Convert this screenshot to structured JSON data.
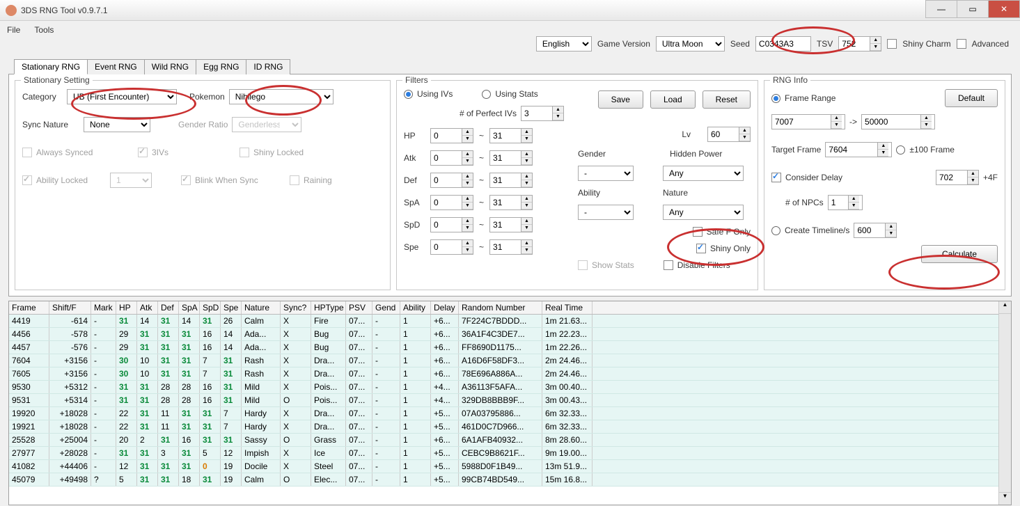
{
  "title": "3DS RNG Tool v0.9.7.1",
  "menu": {
    "file": "File",
    "tools": "Tools"
  },
  "top": {
    "language": "English",
    "gv_label": "Game Version",
    "gv": "Ultra Moon",
    "seed_label": "Seed",
    "seed": "C0343A3",
    "tsv_label": "TSV",
    "tsv": "752",
    "shinycharm": "Shiny Charm",
    "advanced": "Advanced"
  },
  "tabs": [
    "Stationary RNG",
    "Event RNG",
    "Wild RNG",
    "Egg RNG",
    "ID RNG"
  ],
  "stationary": {
    "title": "Stationary Setting",
    "cat_label": "Category",
    "cat": "UB (First Encounter)",
    "poke_label": "Pokemon",
    "poke": "Nihilego",
    "sync_label": "Sync Nature",
    "sync": "None",
    "gender_ratio_label": "Gender Ratio",
    "gender_ratio": "Genderless",
    "always_synced": "Always Synced",
    "threeiv": "3IVs",
    "shinylocked": "Shiny Locked",
    "abilitylocked": "Ability Locked",
    "ability_sel": "1",
    "blink": "Blink When Sync",
    "raining": "Raining"
  },
  "filters": {
    "title": "Filters",
    "save": "Save",
    "load": "Load",
    "reset": "Reset",
    "using_ivs": "Using IVs",
    "using_stats": "Using Stats",
    "perfect_label": "# of Perfect IVs",
    "perfect": "3",
    "hp": "HP",
    "atk": "Atk",
    "def": "Def",
    "spa": "SpA",
    "spd": "SpD",
    "spe": "Spe",
    "tilde": "~",
    "iv_lo": "0",
    "iv_hi": "31",
    "lv_label": "Lv",
    "lv": "60",
    "hidden_label": "Hidden Power",
    "hidden": "Any",
    "gender_label": "Gender",
    "gender": "-",
    "nature_label": "Nature",
    "nature": "Any",
    "ability_label": "Ability",
    "ability": "-",
    "safefonly": "Safe F Only",
    "shinyonly": "Shiny Only",
    "showstats": "Show Stats",
    "disable": "Disable Filters"
  },
  "rng": {
    "title": "RNG Info",
    "default": "Default",
    "frame_range": "Frame Range",
    "from": "7007",
    "to": "50000",
    "arrow": "->",
    "tf_label": "Target Frame",
    "tf": "7604",
    "pm100": "±100 Frame",
    "consider": "Consider Delay",
    "delay": "702",
    "plus4": "+4F",
    "npc_label": "# of NPCs",
    "npc": "1",
    "timeline": "Create Timeline/s",
    "timeline_v": "600",
    "calculate": "Calculate"
  },
  "grid": {
    "headers": [
      "Frame",
      "Shift/F",
      "Mark",
      "HP",
      "Atk",
      "Def",
      "SpA",
      "SpD",
      "Spe",
      "Nature",
      "Sync?",
      "HPType",
      "PSV",
      "Gend",
      "Ability",
      "Delay",
      "Random Number",
      "Real Time"
    ],
    "rows": [
      {
        "f": "4419",
        "s": "-614",
        "m": "-",
        "hp": "31",
        "atk": "14",
        "def": "31",
        "spa": "14",
        "spd": "31",
        "spe": "26",
        "nat": "Calm",
        "sy": "X",
        "hpt": "Fire",
        "psv": "07...",
        "gen": "-",
        "abi": "1",
        "del": "+6...",
        "rand": "7F224C7BDDD...",
        "time": "1m 21.63...",
        "g": [
          "hp",
          "def",
          "spd"
        ]
      },
      {
        "f": "4456",
        "s": "-578",
        "m": "-",
        "hp": "29",
        "atk": "31",
        "def": "31",
        "spa": "31",
        "spd": "16",
        "spe": "14",
        "nat": "Ada...",
        "sy": "X",
        "hpt": "Bug",
        "psv": "07...",
        "gen": "-",
        "abi": "1",
        "del": "+6...",
        "rand": "36A1F4C3DE7...",
        "time": "1m 22.23...",
        "g": [
          "atk",
          "def",
          "spa"
        ]
      },
      {
        "f": "4457",
        "s": "-576",
        "m": "-",
        "hp": "29",
        "atk": "31",
        "def": "31",
        "spa": "31",
        "spd": "16",
        "spe": "14",
        "nat": "Ada...",
        "sy": "X",
        "hpt": "Bug",
        "psv": "07...",
        "gen": "-",
        "abi": "1",
        "del": "+6...",
        "rand": "FF8690D1175...",
        "time": "1m 22.26...",
        "g": [
          "atk",
          "def",
          "spa"
        ]
      },
      {
        "f": "7604",
        "s": "+3156",
        "m": "-",
        "hp": "30",
        "atk": "10",
        "def": "31",
        "spa": "31",
        "spd": "7",
        "spe": "31",
        "nat": "Rash",
        "sy": "X",
        "hpt": "Dra...",
        "psv": "07...",
        "gen": "-",
        "abi": "1",
        "del": "+6...",
        "rand": "A16D6F58DF3...",
        "time": "2m 24.46...",
        "g": [
          "hp",
          "def",
          "spa",
          "spe"
        ]
      },
      {
        "f": "7605",
        "s": "+3156",
        "m": "-",
        "hp": "30",
        "atk": "10",
        "def": "31",
        "spa": "31",
        "spd": "7",
        "spe": "31",
        "nat": "Rash",
        "sy": "X",
        "hpt": "Dra...",
        "psv": "07...",
        "gen": "-",
        "abi": "1",
        "del": "+6...",
        "rand": "78E696A886A...",
        "time": "2m 24.46...",
        "g": [
          "hp",
          "def",
          "spa",
          "spe"
        ]
      },
      {
        "f": "9530",
        "s": "+5312",
        "m": "-",
        "hp": "31",
        "atk": "31",
        "def": "28",
        "spa": "28",
        "spd": "16",
        "spe": "31",
        "nat": "Mild",
        "sy": "X",
        "hpt": "Pois...",
        "psv": "07...",
        "gen": "-",
        "abi": "1",
        "del": "+4...",
        "rand": "A36113F5AFA...",
        "time": "3m 00.40...",
        "g": [
          "hp",
          "atk",
          "spe"
        ]
      },
      {
        "f": "9531",
        "s": "+5314",
        "m": "-",
        "hp": "31",
        "atk": "31",
        "def": "28",
        "spa": "28",
        "spd": "16",
        "spe": "31",
        "nat": "Mild",
        "sy": "O",
        "hpt": "Pois...",
        "psv": "07...",
        "gen": "-",
        "abi": "1",
        "del": "+4...",
        "rand": "329DB8BBB9F...",
        "time": "3m 00.43...",
        "g": [
          "hp",
          "atk",
          "spe"
        ]
      },
      {
        "f": "19920",
        "s": "+18028",
        "m": "-",
        "hp": "22",
        "atk": "31",
        "def": "11",
        "spa": "31",
        "spd": "31",
        "spe": "7",
        "nat": "Hardy",
        "sy": "X",
        "hpt": "Dra...",
        "psv": "07...",
        "gen": "-",
        "abi": "1",
        "del": "+5...",
        "rand": "07A03795886...",
        "time": "6m 32.33...",
        "g": [
          "atk",
          "spa",
          "spd"
        ]
      },
      {
        "f": "19921",
        "s": "+18028",
        "m": "-",
        "hp": "22",
        "atk": "31",
        "def": "11",
        "spa": "31",
        "spd": "31",
        "spe": "7",
        "nat": "Hardy",
        "sy": "X",
        "hpt": "Dra...",
        "psv": "07...",
        "gen": "-",
        "abi": "1",
        "del": "+5...",
        "rand": "461D0C7D966...",
        "time": "6m 32.33...",
        "g": [
          "atk",
          "spa",
          "spd"
        ]
      },
      {
        "f": "25528",
        "s": "+25004",
        "m": "-",
        "hp": "20",
        "atk": "2",
        "def": "31",
        "spa": "16",
        "spd": "31",
        "spe": "31",
        "nat": "Sassy",
        "sy": "O",
        "hpt": "Grass",
        "psv": "07...",
        "gen": "-",
        "abi": "1",
        "del": "+6...",
        "rand": "6A1AFB40932...",
        "time": "8m 28.60...",
        "g": [
          "def",
          "spd",
          "spe"
        ]
      },
      {
        "f": "27977",
        "s": "+28028",
        "m": "-",
        "hp": "31",
        "atk": "31",
        "def": "3",
        "spa": "31",
        "spd": "5",
        "spe": "12",
        "nat": "Impish",
        "sy": "X",
        "hpt": "Ice",
        "psv": "07...",
        "gen": "-",
        "abi": "1",
        "del": "+5...",
        "rand": "CEBC9B8621F...",
        "time": "9m 19.00...",
        "g": [
          "hp",
          "atk",
          "spa"
        ]
      },
      {
        "f": "41082",
        "s": "+44406",
        "m": "-",
        "hp": "12",
        "atk": "31",
        "def": "31",
        "spa": "31",
        "spd": "0",
        "spe": "19",
        "nat": "Docile",
        "sy": "X",
        "hpt": "Steel",
        "psv": "07...",
        "gen": "-",
        "abi": "1",
        "del": "+5...",
        "rand": "5988D0F1B49...",
        "time": "13m 51.9...",
        "g": [
          "atk",
          "def",
          "spa"
        ],
        "o": [
          "spd"
        ]
      },
      {
        "f": "45079",
        "s": "+49498",
        "m": "?",
        "hp": "5",
        "atk": "31",
        "def": "31",
        "spa": "18",
        "spd": "31",
        "spe": "19",
        "nat": "Calm",
        "sy": "O",
        "hpt": "Elec...",
        "psv": "07...",
        "gen": "-",
        "abi": "1",
        "del": "+5...",
        "rand": "99CB74BD549...",
        "time": "15m 16.8...",
        "g": [
          "atk",
          "def",
          "spd"
        ]
      }
    ]
  }
}
